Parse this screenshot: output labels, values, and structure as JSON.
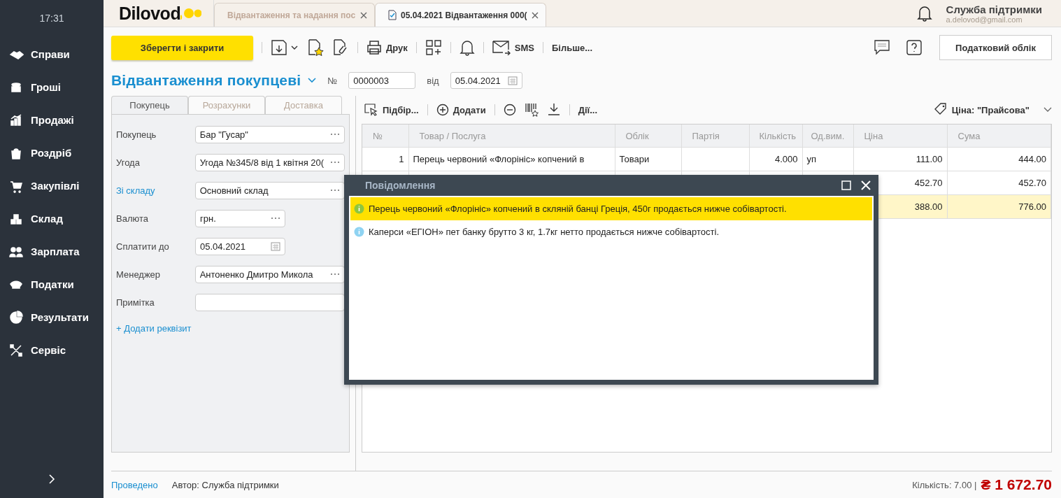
{
  "sidebar": {
    "time": "17:31",
    "items": [
      {
        "label": "Справи"
      },
      {
        "label": "Гроші"
      },
      {
        "label": "Продажі"
      },
      {
        "label": "Роздріб"
      },
      {
        "label": "Закупівлі"
      },
      {
        "label": "Склад"
      },
      {
        "label": "Зарплата"
      },
      {
        "label": "Податки"
      },
      {
        "label": "Результати"
      },
      {
        "label": "Сервіс"
      }
    ]
  },
  "logo": {
    "text": "Dilovod"
  },
  "tabs": [
    {
      "label": "Відвантаження та надання пос",
      "selected": false
    },
    {
      "label": "05.04.2021 Відвантаження 000(",
      "selected": true
    }
  ],
  "user": {
    "name": "Служба підтримки",
    "email": "a.delovod@gmail.com"
  },
  "toolbar": {
    "save_close": "Зберегти і закрити",
    "print": "Друк",
    "sms": "SMS",
    "more": "Більше...",
    "tax": "Податковий облік"
  },
  "document": {
    "title": "Відвантаження покупцеві",
    "number_label": "№",
    "number": "0000003",
    "date_label": "від",
    "date": "05.04.2021"
  },
  "form_tabs": [
    {
      "label": "Покупець",
      "selected": true
    },
    {
      "label": "Розрахунки",
      "selected": false
    },
    {
      "label": "Доставка",
      "selected": false
    }
  ],
  "fields": [
    {
      "label": "Покупець",
      "value": "Бар \"Гусар\"",
      "kind": "select",
      "link": false
    },
    {
      "label": "Угода",
      "value": "Угода №345/8 від 1 квітня 20(",
      "kind": "select",
      "link": false
    },
    {
      "label": "Зі складу",
      "value": "Основний склад",
      "kind": "select",
      "link": true
    },
    {
      "label": "Валюта",
      "value": "грн.",
      "kind": "short",
      "link": false
    },
    {
      "label": "Сплатити до",
      "value": "05.04.2021",
      "kind": "date",
      "link": false
    },
    {
      "label": "Менеджер",
      "value": "Антоненко Дмитро Микола",
      "kind": "select",
      "link": false
    },
    {
      "label": "Примітка",
      "kind": "text",
      "link": false
    }
  ],
  "add_field": "+ Додати реквізит",
  "table_toolbar": {
    "pick": "Підбір...",
    "add": "Додати",
    "actions": "Дії...",
    "price": "Ціна: \"Прайсова\""
  },
  "table": {
    "columns": [
      "№",
      "Товар / Послуга",
      "Облік",
      "Партія",
      "Кількість",
      "Од.вим.",
      "Ціна",
      "Сума"
    ],
    "rows": [
      {
        "selected": false,
        "cells": [
          "1",
          "Перець червоний «Флорініс» копчений в",
          "Товари",
          "",
          "4.000",
          "уп",
          "111.00",
          "444.00"
        ]
      },
      {
        "selected": false,
        "cells": [
          "",
          "",
          "",
          "",
          "",
          "",
          "452.70",
          "452.70"
        ]
      },
      {
        "selected": true,
        "cells": [
          "",
          "",
          "",
          "",
          "",
          "",
          "388.00",
          "776.00"
        ]
      }
    ]
  },
  "dialog": {
    "title": "Повідомлення",
    "messages": [
      {
        "text": "Перець червоний «Флорініс» копчений в скляній банці Греція, 450г продається нижче собівартості.",
        "selected": true,
        "color": "#8dc63f"
      },
      {
        "text": "Каперси «ЕГІОН» пет банку брутто 3 кг, 1.7кг нетто продається нижче собівартості.",
        "selected": false,
        "color": "#8fd3f2"
      }
    ]
  },
  "footer": {
    "status": "Проведено",
    "author": "Автор: Служба підтримки",
    "quantity": "Кількість: 7.00 |",
    "total": "₴ 1 672.70"
  }
}
